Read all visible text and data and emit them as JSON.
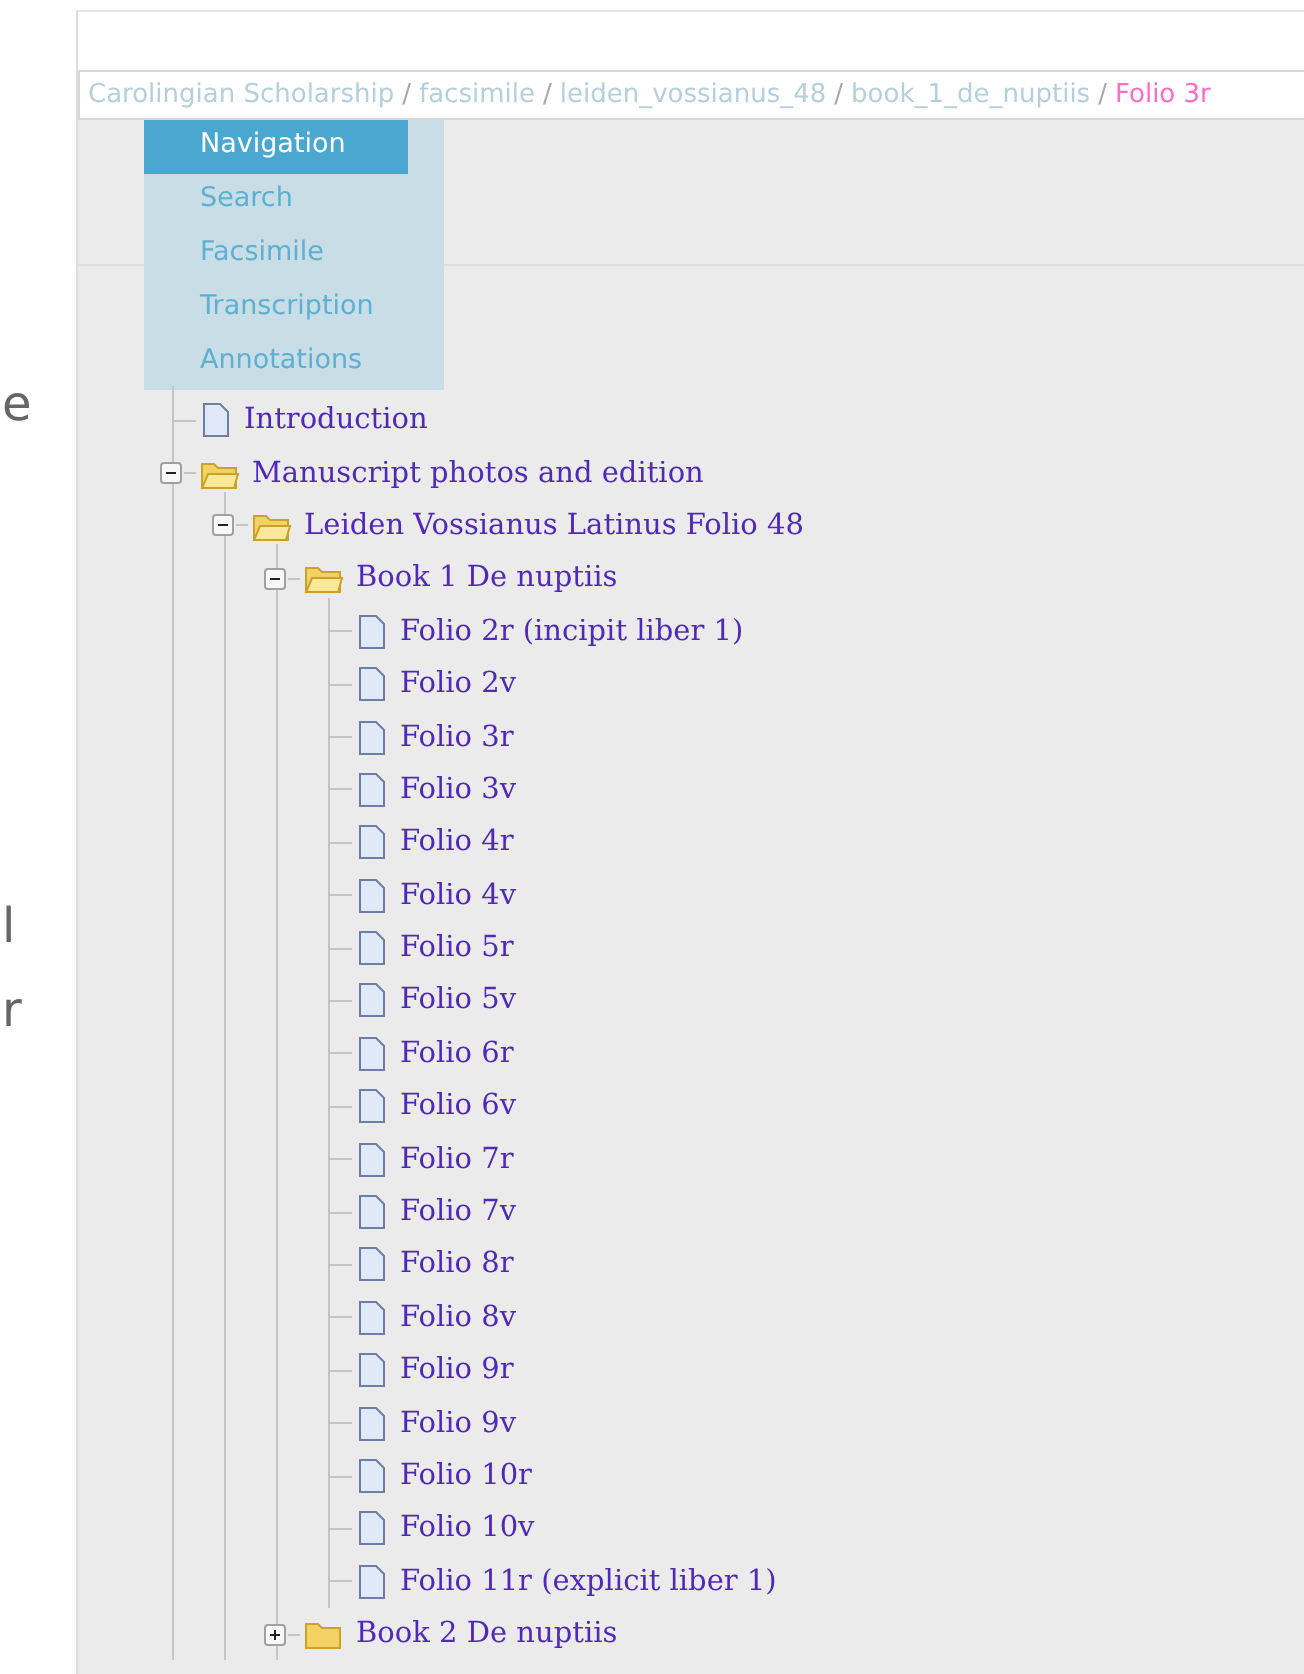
{
  "edge_fragments": [
    "e",
    "l",
    "r"
  ],
  "breadcrumb_separator": "/",
  "breadcrumb": [
    {
      "label": "Carolingian Scholarship",
      "current": false
    },
    {
      "label": "facsimile",
      "current": false
    },
    {
      "label": "leiden_vossianus_48",
      "current": false
    },
    {
      "label": "book_1_de_nuptiis",
      "current": false
    },
    {
      "label": "Folio 3r",
      "current": true
    }
  ],
  "menu": [
    {
      "label": "Navigation",
      "selected": true
    },
    {
      "label": "Search",
      "selected": false
    },
    {
      "label": "Facsimile",
      "selected": false
    },
    {
      "label": "Transcription",
      "selected": false
    },
    {
      "label": "Annotations",
      "selected": false
    }
  ],
  "tree": [
    {
      "kind": "page",
      "label": "Introduction"
    },
    {
      "kind": "folder",
      "label": "Manuscript photos and edition",
      "expanded": true,
      "children": [
        {
          "kind": "folder",
          "label": "Leiden Vossianus Latinus Folio 48",
          "expanded": true,
          "children": [
            {
              "kind": "folder",
              "label": "Book 1 De nuptiis",
              "expanded": true,
              "children": [
                {
                  "kind": "page",
                  "label": "Folio 2r (incipit liber 1)"
                },
                {
                  "kind": "page",
                  "label": "Folio 2v"
                },
                {
                  "kind": "page",
                  "label": "Folio 3r"
                },
                {
                  "kind": "page",
                  "label": "Folio 3v"
                },
                {
                  "kind": "page",
                  "label": "Folio 4r"
                },
                {
                  "kind": "page",
                  "label": "Folio 4v"
                },
                {
                  "kind": "page",
                  "label": "Folio 5r"
                },
                {
                  "kind": "page",
                  "label": "Folio 5v"
                },
                {
                  "kind": "page",
                  "label": "Folio 6r"
                },
                {
                  "kind": "page",
                  "label": "Folio 6v"
                },
                {
                  "kind": "page",
                  "label": "Folio 7r"
                },
                {
                  "kind": "page",
                  "label": "Folio 7v"
                },
                {
                  "kind": "page",
                  "label": "Folio 8r"
                },
                {
                  "kind": "page",
                  "label": "Folio 8v"
                },
                {
                  "kind": "page",
                  "label": "Folio 9r"
                },
                {
                  "kind": "page",
                  "label": "Folio 9v"
                },
                {
                  "kind": "page",
                  "label": "Folio 10r"
                },
                {
                  "kind": "page",
                  "label": "Folio 10v"
                },
                {
                  "kind": "page",
                  "label": "Folio 11r (explicit liber 1)"
                }
              ]
            },
            {
              "kind": "folder",
              "label": "Book 2 De nuptiis",
              "expanded": false
            }
          ]
        }
      ]
    }
  ]
}
